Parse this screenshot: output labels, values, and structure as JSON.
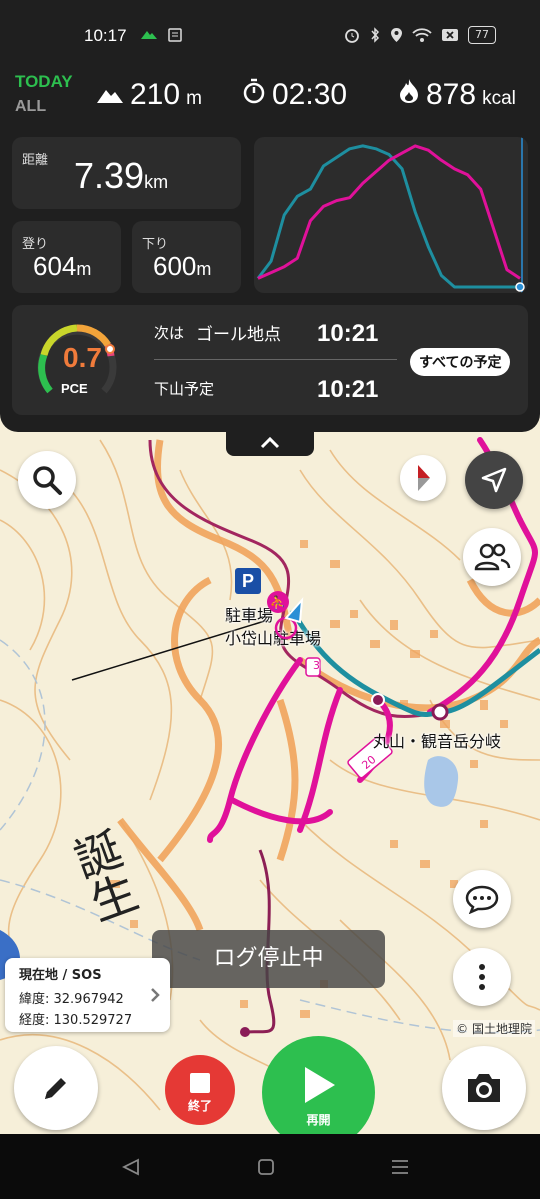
{
  "status_bar": {
    "time": "10:17",
    "battery": "77",
    "icons": [
      "mountain-icon",
      "notes-icon",
      "alarm-icon",
      "bluetooth-icon",
      "location-icon",
      "wifi-icon",
      "close-box-icon",
      "battery-icon"
    ]
  },
  "dashboard": {
    "today_label": "TODAY",
    "all_label": "ALL",
    "elevation_value": "210",
    "elevation_unit": "m",
    "time_value": "02:30",
    "calories_value": "878",
    "calories_unit": "kcal",
    "distance_label": "距離",
    "distance_value": "7.39",
    "distance_unit": "km",
    "ascent_label": "登り",
    "ascent_value": "604",
    "ascent_unit": "m",
    "descent_label": "下り",
    "descent_value": "600",
    "descent_unit": "m",
    "pce_value": "0.7",
    "pce_label": "PCE",
    "next_label": "次は",
    "next_place": "ゴール地点",
    "next_time": "10:21",
    "descent_plan_label": "下山予定",
    "descent_plan_time": "10:21",
    "all_schedule_button": "すべての予定",
    "colors": {
      "accent_green": "#2dbf4f",
      "pce_orange": "#f07b3b",
      "track_magenta": "#e0119a",
      "plan_teal": "#1e8fa0"
    }
  },
  "chart_data": {
    "type": "line",
    "title": "",
    "xlabel": "",
    "ylabel": "",
    "ylim": [
      0,
      1
    ],
    "x": [
      0,
      0.05,
      0.1,
      0.15,
      0.2,
      0.25,
      0.3,
      0.35,
      0.4,
      0.45,
      0.5,
      0.55,
      0.6,
      0.65,
      0.7,
      0.75,
      0.8,
      0.85,
      0.9,
      0.95,
      1.0
    ],
    "series": [
      {
        "color": "#1e8fa0",
        "values": [
          0.06,
          0.18,
          0.5,
          0.63,
          0.68,
          0.84,
          0.9,
          0.96,
          0.98,
          0.96,
          0.92,
          0.82,
          0.52,
          0.28,
          0.08,
          0.0,
          0.0,
          0.0,
          0.0,
          0.0,
          0.0
        ]
      },
      {
        "color": "#e0119a",
        "values": [
          0.06,
          0.1,
          0.14,
          0.2,
          0.46,
          0.56,
          0.6,
          0.62,
          0.72,
          0.8,
          0.88,
          0.93,
          0.98,
          0.95,
          0.88,
          0.82,
          0.78,
          0.68,
          0.4,
          0.12,
          0.06
        ]
      }
    ],
    "grid": false,
    "legend": "none"
  },
  "map": {
    "parking_label": "駐車場",
    "parking_name": "小岱山駐車場",
    "junction_label": "丸山・観音岳分岐",
    "route_number": "3",
    "route_marker": "20",
    "kanji_label": "誕生",
    "log_stop_label": "ログ停止中",
    "location_card_title": "現在地 / SOS",
    "latitude_label": "緯度: 32.967942",
    "longitude_label": "経度: 130.529727",
    "copyright": "© 国土地理院"
  },
  "controls": {
    "stop_label": "終了",
    "resume_label": "再開",
    "icons": [
      "search-icon",
      "compass-icon",
      "navigate-icon",
      "group-icon",
      "chat-icon",
      "more-icon",
      "pencil-icon",
      "camera-icon"
    ]
  }
}
